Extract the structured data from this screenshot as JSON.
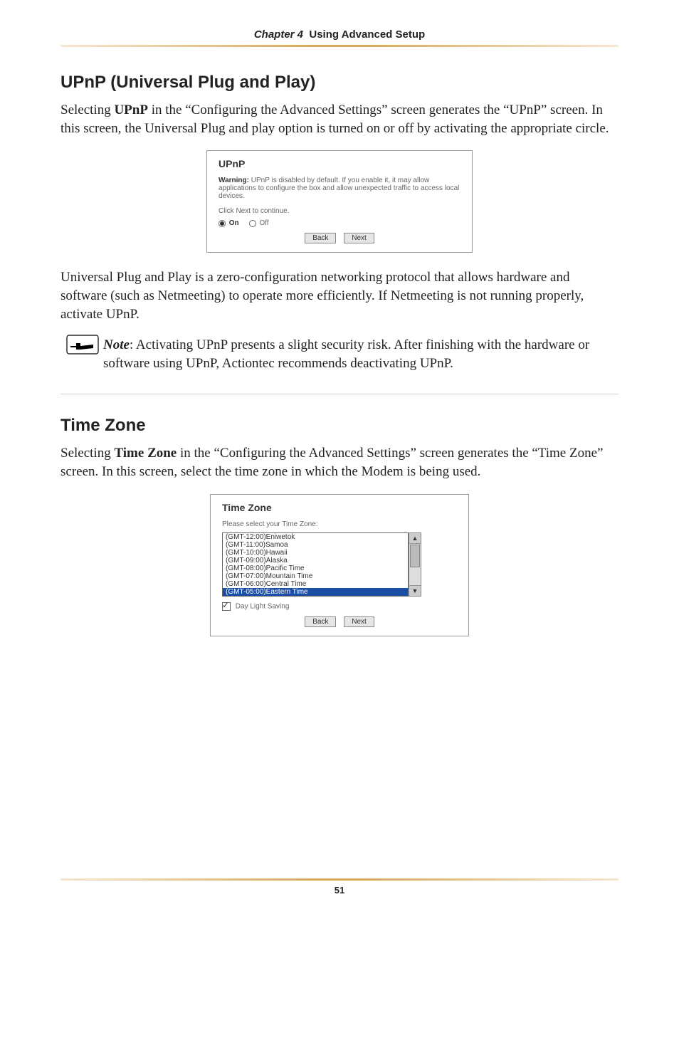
{
  "header": {
    "chapter": "Chapter 4",
    "title": "Using Advanced Setup"
  },
  "upnp": {
    "heading": "UPnP (Universal Plug and Play)",
    "para1_pre": "Selecting ",
    "para1_bold": "UPnP",
    "para1_post": " in the “Configuring the Advanced Settings” screen generates the “UPnP” screen. In this screen, the Universal Plug and play option is turned on or off by activating the appropriate circle.",
    "fig": {
      "title": "UPnP",
      "warn_label": "Warning:",
      "warn_text": " UPnP is disabled by default. If you enable it, it may allow applications to configure the box and allow unexpected traffic to access local devices.",
      "click_next": "Click Next to continue.",
      "on": "On",
      "off": "Off",
      "back": "Back",
      "next": "Next"
    },
    "para2": "Universal Plug and Play is a zero-configuration networking protocol that allows hardware and software (such as Netmeeting) to operate more efficiently. If Netmeeting is not running properly, activate UPnP.",
    "note_label": "Note",
    "note_text": ": Activating UPnP presents a slight security risk. After finishing with the hardware or software using UPnP, Actiontec recommends deactivating UPnP."
  },
  "tz": {
    "heading": "Time Zone",
    "para_pre": "Selecting ",
    "para_bold": "Time Zone",
    "para_post": " in the “Configuring the Advanced Settings” screen generates the “Time Zone” screen. In this screen, select the time zone in which the Modem is being used.",
    "fig": {
      "title": "Time Zone",
      "prompt": "Please select your Time Zone:",
      "options": [
        "(GMT-12:00)Eniwetok",
        "(GMT-11:00)Samoa",
        "(GMT-10:00)Hawaii",
        "(GMT-09:00)Alaska",
        "(GMT-08:00)Pacific Time",
        "(GMT-07:00)Mountain Time",
        "(GMT-06:00)Central Time",
        "(GMT-05:00)Eastern Time"
      ],
      "selected_index": 7,
      "dls": "Day Light Saving",
      "back": "Back",
      "next": "Next"
    }
  },
  "page_number": "51"
}
